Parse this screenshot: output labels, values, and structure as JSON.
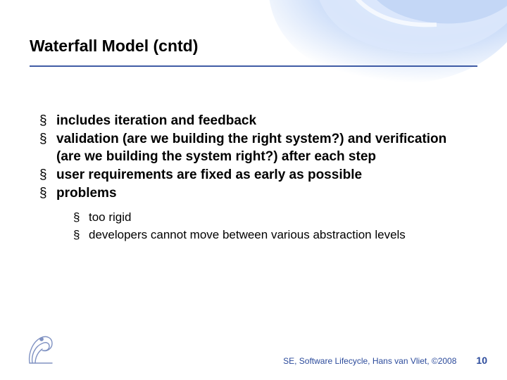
{
  "title": "Waterfall Model (cntd)",
  "bullets": {
    "b1": "includes iteration and feedback",
    "b2": "validation (are we building the right system?) and verification (are we building the system right?) after each step",
    "b3": "user requirements are fixed as early as possible",
    "b4": "problems",
    "sub1": "too rigid",
    "sub2": "developers cannot move between various abstraction levels"
  },
  "footer": {
    "text": "SE, Software Lifecycle, Hans van Vliet, ©2008",
    "page": "10"
  },
  "colors": {
    "accent": "#2b4a9b",
    "swirl_light": "#d7e4fb",
    "swirl_mid": "#b3c9f0"
  }
}
